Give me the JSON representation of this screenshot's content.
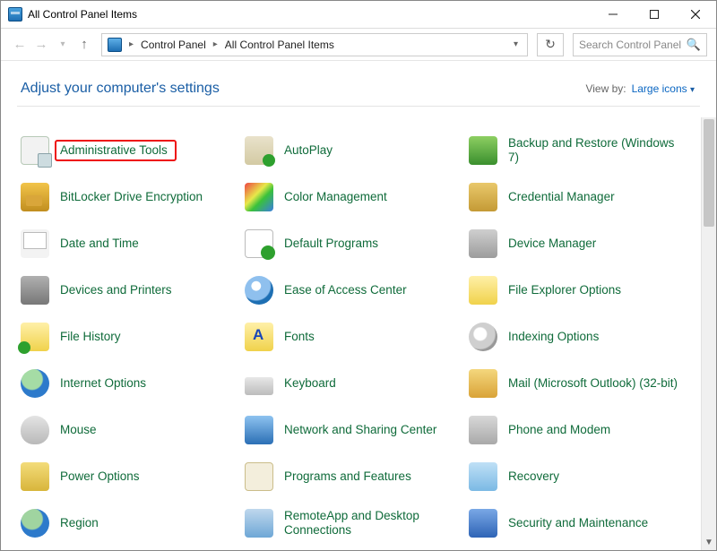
{
  "window": {
    "title": "All Control Panel Items"
  },
  "nav": {
    "address_icon": "control-panel-icon",
    "breadcrumbs": [
      "Control Panel",
      "All Control Panel Items"
    ]
  },
  "search": {
    "placeholder": "Search Control Panel"
  },
  "header": {
    "title": "Adjust your computer's settings",
    "viewby_label": "View by:",
    "viewby_value": "Large icons"
  },
  "items": [
    {
      "label": "Administrative Tools",
      "icon": "ic-admin",
      "highlighted": true
    },
    {
      "label": "AutoPlay",
      "icon": "ic-autoplay"
    },
    {
      "label": "Backup and Restore (Windows 7)",
      "icon": "ic-backup"
    },
    {
      "label": "BitLocker Drive Encryption",
      "icon": "ic-bitlocker"
    },
    {
      "label": "Color Management",
      "icon": "ic-color"
    },
    {
      "label": "Credential Manager",
      "icon": "ic-cred"
    },
    {
      "label": "Date and Time",
      "icon": "ic-date"
    },
    {
      "label": "Default Programs",
      "icon": "ic-defprog"
    },
    {
      "label": "Device Manager",
      "icon": "ic-devmgr"
    },
    {
      "label": "Devices and Printers",
      "icon": "ic-devprint"
    },
    {
      "label": "Ease of Access Center",
      "icon": "ic-ease"
    },
    {
      "label": "File Explorer Options",
      "icon": "ic-fileexp"
    },
    {
      "label": "File History",
      "icon": "ic-filehist"
    },
    {
      "label": "Fonts",
      "icon": "ic-fonts"
    },
    {
      "label": "Indexing Options",
      "icon": "ic-index"
    },
    {
      "label": "Internet Options",
      "icon": "ic-inet"
    },
    {
      "label": "Keyboard",
      "icon": "ic-kbd"
    },
    {
      "label": "Mail (Microsoft Outlook) (32-bit)",
      "icon": "ic-mail"
    },
    {
      "label": "Mouse",
      "icon": "ic-mouse"
    },
    {
      "label": "Network and Sharing Center",
      "icon": "ic-netshare"
    },
    {
      "label": "Phone and Modem",
      "icon": "ic-phone"
    },
    {
      "label": "Power Options",
      "icon": "ic-power"
    },
    {
      "label": "Programs and Features",
      "icon": "ic-progfeat"
    },
    {
      "label": "Recovery",
      "icon": "ic-recovery"
    },
    {
      "label": "Region",
      "icon": "ic-region"
    },
    {
      "label": "RemoteApp and Desktop Connections",
      "icon": "ic-remote"
    },
    {
      "label": "Security and Maintenance",
      "icon": "ic-security"
    }
  ]
}
